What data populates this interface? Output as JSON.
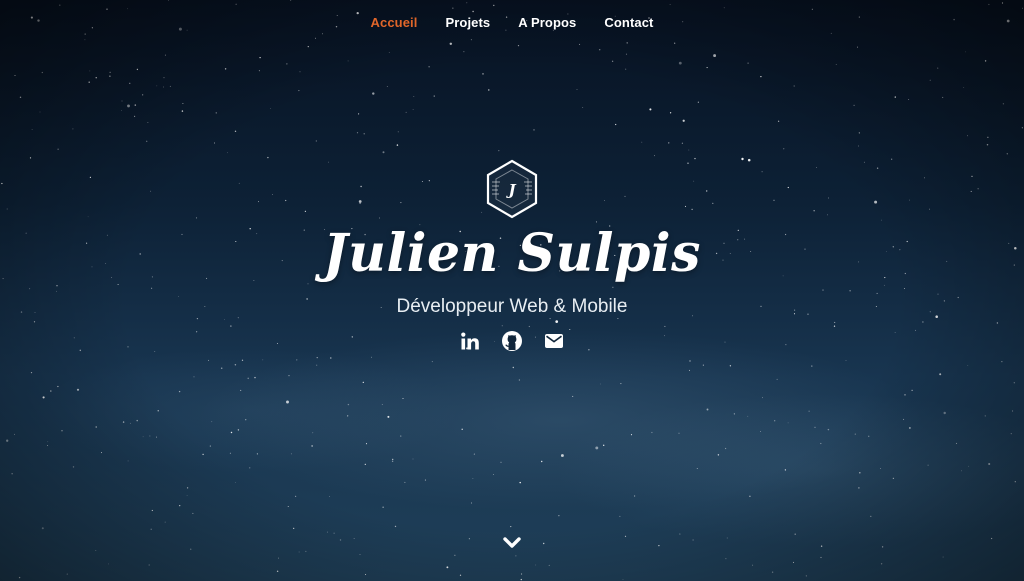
{
  "nav": {
    "items": [
      {
        "label": "Accueil",
        "active": true
      },
      {
        "label": "Projets",
        "active": false
      },
      {
        "label": "A Propos",
        "active": false
      },
      {
        "label": "Contact",
        "active": false
      }
    ],
    "active_color": "#e0662a",
    "text_color": "#ffffff"
  },
  "hero": {
    "logo_letter": "J",
    "logo_icon": "hexagon-logo-icon",
    "name": "Julien Sulpis",
    "subtitle": "Développeur Web & Mobile",
    "socials": [
      {
        "icon": "linkedin-icon"
      },
      {
        "icon": "github-icon"
      },
      {
        "icon": "email-icon"
      }
    ]
  },
  "scroll": {
    "icon": "chevron-down-icon"
  },
  "background": {
    "description_icon": "starry-sky-background",
    "colors": [
      "#071222",
      "#183550",
      "#1f3f58"
    ]
  }
}
